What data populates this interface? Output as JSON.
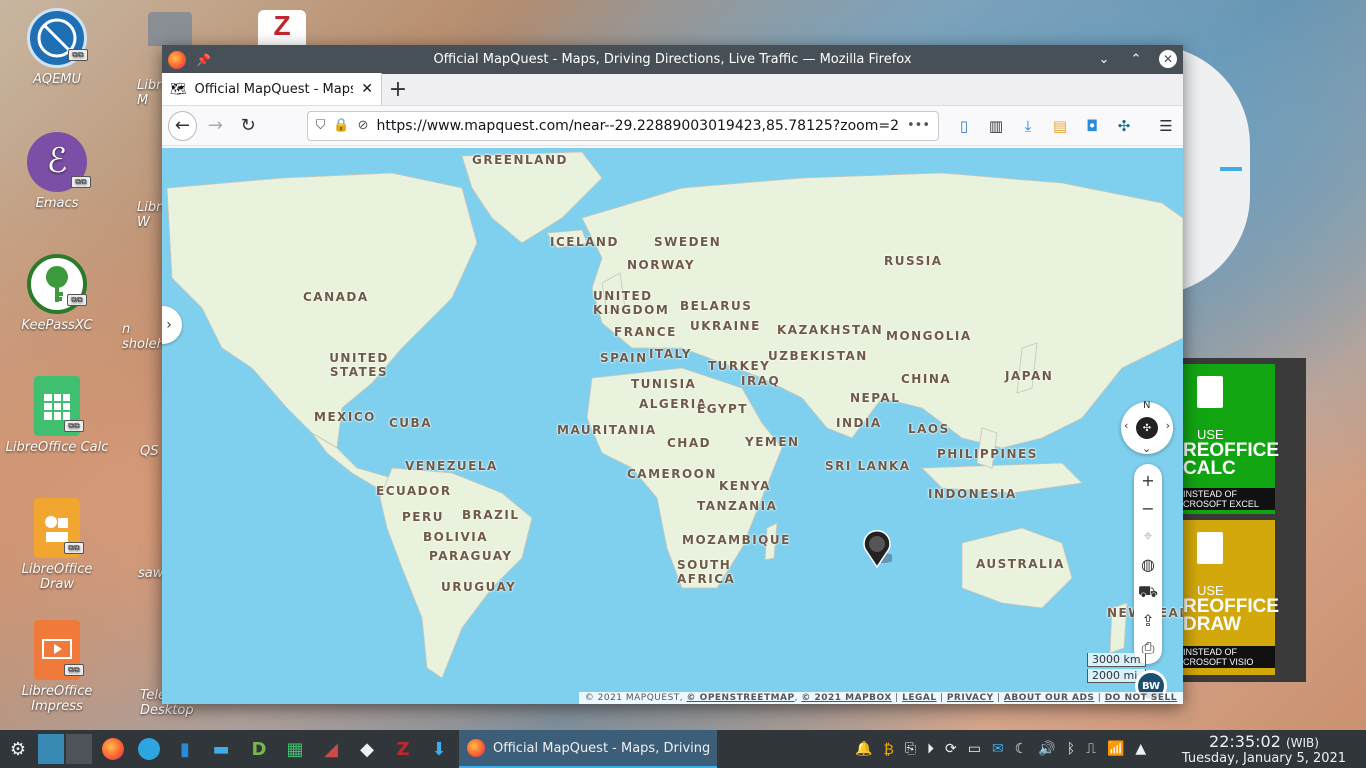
{
  "desktop": {
    "icons": [
      {
        "label": "AQEMU"
      },
      {
        "label": "Emacs"
      },
      {
        "label": "KeePassXC"
      },
      {
        "label": "LibreOffice Calc"
      },
      {
        "label": "LibreOffice Draw"
      },
      {
        "label": "LibreOffice Impress"
      }
    ],
    "partial_icons": [
      {
        "label": "Libre M"
      },
      {
        "label": "Libre W"
      },
      {
        "label": "n sholeh"
      },
      {
        "label": "QS"
      },
      {
        "label": "saw"
      },
      {
        "label": "Tele Desktop"
      }
    ]
  },
  "window": {
    "title": "Official MapQuest - Maps, Driving Directions, Live Traffic — Mozilla Firefox",
    "tab_title": "Official MapQuest - Maps, Driving Directions, Live Traffic",
    "url": "https://www.mapquest.com/near--29.22889003019423,85.78125?zoom=2",
    "url_more": "•••"
  },
  "map": {
    "labels": [
      {
        "text": "GREENLAND"
      },
      {
        "text": "ICELAND"
      },
      {
        "text": "SWEDEN"
      },
      {
        "text": "NORWAY"
      },
      {
        "text": "RUSSIA"
      },
      {
        "text": "CANADA"
      },
      {
        "text": "UNITED KINGDOM"
      },
      {
        "text": "BELARUS"
      },
      {
        "text": "FRANCE"
      },
      {
        "text": "UKRAINE"
      },
      {
        "text": "KAZAKHSTAN"
      },
      {
        "text": "MONGOLIA"
      },
      {
        "text": "SPAIN"
      },
      {
        "text": "ITALY"
      },
      {
        "text": "UZBEKISTAN"
      },
      {
        "text": "UNITED STATES"
      },
      {
        "text": "TURKEY"
      },
      {
        "text": "TUNISIA"
      },
      {
        "text": "IRAQ"
      },
      {
        "text": "CHINA"
      },
      {
        "text": "JAPAN"
      },
      {
        "text": "ALGERIA"
      },
      {
        "text": "EGYPT"
      },
      {
        "text": "NEPAL"
      },
      {
        "text": "MEXICO"
      },
      {
        "text": "CUBA"
      },
      {
        "text": "INDIA"
      },
      {
        "text": "MAURITANIA"
      },
      {
        "text": "CHAD"
      },
      {
        "text": "YEMEN"
      },
      {
        "text": "LAOS"
      },
      {
        "text": "VENEZUELA"
      },
      {
        "text": "SRI LANKA"
      },
      {
        "text": "PHILIPPINES"
      },
      {
        "text": "CAMEROON"
      },
      {
        "text": "ECUADOR"
      },
      {
        "text": "KENYA"
      },
      {
        "text": "INDONESIA"
      },
      {
        "text": "PERU"
      },
      {
        "text": "BRAZIL"
      },
      {
        "text": "TANZANIA"
      },
      {
        "text": "BOLIVIA"
      },
      {
        "text": "PARAGUAY"
      },
      {
        "text": "MOZAMBIQUE"
      },
      {
        "text": "AUSTRALIA"
      },
      {
        "text": "SOUTH AFRICA"
      },
      {
        "text": "URUGUAY"
      },
      {
        "text": "NEW ZEALA"
      }
    ],
    "compass_n": "N",
    "scale_km": "3000 km",
    "scale_mi": "2000 mi",
    "attribution": {
      "copyright": "© 2021 MAPQUEST,",
      "osm": "© OPENSTREETMAP",
      "mapbox": "© 2021 MAPBOX",
      "legal": "LEGAL",
      "privacy": "PRIVACY",
      "ads": "ABOUT OUR ADS",
      "dns": "DO NOT SELL"
    },
    "badge": "BW"
  },
  "ads": {
    "calc": {
      "use": "USE",
      "name1": "REOFFICE",
      "name2": "CALC",
      "instead1": "INSTEAD OF",
      "instead2": "CROSOFT EXCEL"
    },
    "draw": {
      "use": "USE",
      "name1": "REOFFICE",
      "name2": "DRAW",
      "instead1": "INSTEAD OF",
      "instead2": "CROSOFT VISIO"
    }
  },
  "taskbar": {
    "task_title": "Official MapQuest - Maps, Driving ...",
    "time": "22:35:02",
    "tz": "(WIB)",
    "date": "Tuesday, January 5, 2021"
  }
}
